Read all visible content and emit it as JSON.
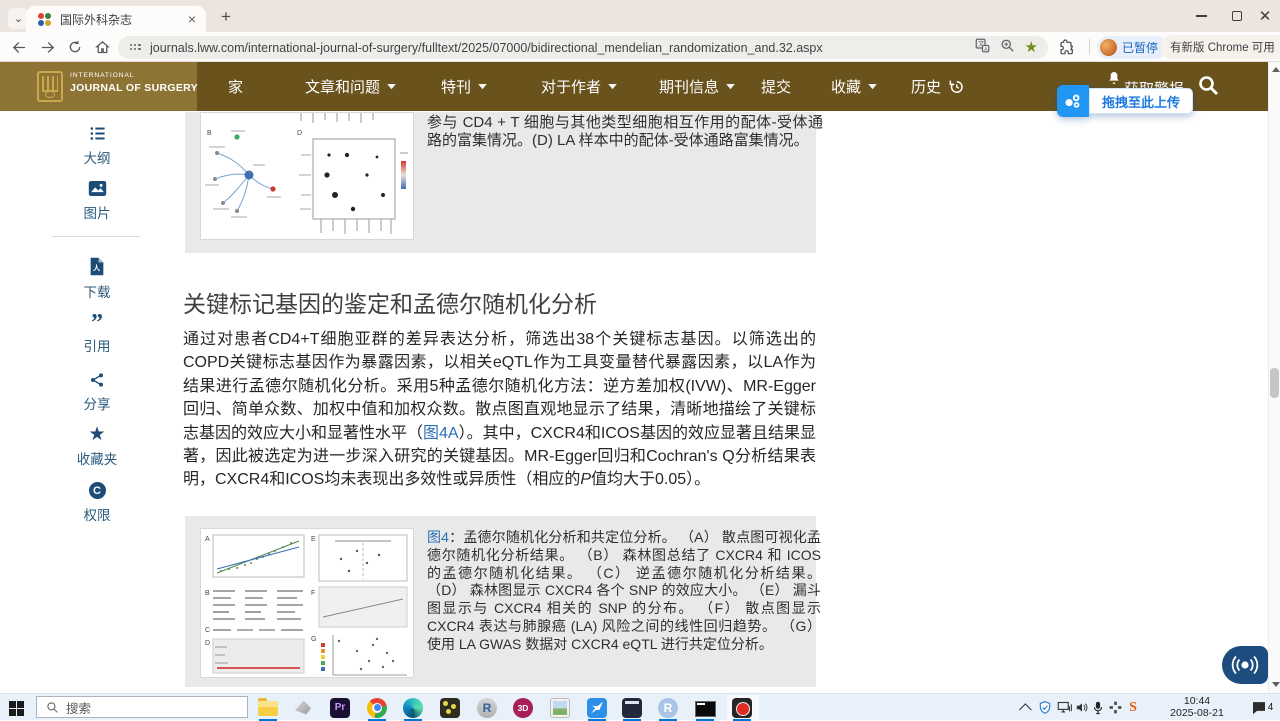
{
  "browser": {
    "tab_title": "国际外科杂志",
    "url": "journals.lww.com/international-journal-of-surgery/fulltext/2025/07000/bidirectional_mendelian_randomization_and.32.aspx",
    "profile_status": "已暂停",
    "update_button": "有新版 Chrome 可用"
  },
  "header": {
    "logo_top": "INTERNATIONAL",
    "logo_bottom": "JOURNAL OF SURGERY",
    "nav": [
      {
        "label": "家"
      },
      {
        "label": "文章和问题"
      },
      {
        "label": "特刊"
      },
      {
        "label": "对于作者"
      },
      {
        "label": "期刊信息"
      },
      {
        "label": "提交"
      },
      {
        "label": "收藏"
      },
      {
        "label": "历史"
      },
      {
        "label": "获取警报"
      }
    ]
  },
  "upload_tooltip": {
    "label": "拖拽至此上传"
  },
  "sidebar": {
    "items": [
      {
        "label": "大纲",
        "icon": "outline-icon"
      },
      {
        "label": "图片",
        "icon": "images-icon"
      },
      {
        "label": "下载",
        "icon": "pdf-download-icon"
      },
      {
        "label": "引用",
        "icon": "cite-icon"
      },
      {
        "label": "分享",
        "icon": "share-icon"
      },
      {
        "label": "收藏夹",
        "icon": "favorites-icon"
      },
      {
        "label": "权限",
        "icon": "permissions-icon"
      }
    ]
  },
  "article": {
    "fig3_caption": "参与 CD4 + T 细胞与其他类型细胞相互作用的配体-受体通路的富集情况。(D) LA 样本中的配体-受体通路富集情况。",
    "section_heading": "关键标记基因的鉴定和孟德尔随机化分析",
    "para_1": "通过对患者CD4+T细胞亚群的差异表达分析，筛选出38个关键标志基因。以筛选出的COPD关键标志基因作为暴露因素，以相关eQTL作为工具变量替代暴露因素，以LA作为结果进行孟德尔随机化分析。采用5种孟德尔随机化方法：逆方差加权(IVW)、MR-Egger回归、简单众数、加权中值和加权众数。散点图直观地显示了结果，清晰地描绘了关键标志基因的效应大小和显著性水平（",
    "para_link": "图4A",
    "para_2": "）。其中，CXCR4和ICOS基因的效应显著且结果显著，因此被选定为进一步深入研究的关键基因。MR-Egger回归和Cochran's Q分析结果表明，CXCR4和ICOS均未表现出多效性或异质性（相应的",
    "para_italic": "P",
    "para_3": "值均大于0.05）。",
    "fig4_label": "图4",
    "fig4_caption": "：孟德尔随机化分析和共定位分析。 （A） 散点图可视化孟德尔随机化分析结果。 （B） 森林图总结了 CXCR4 和 ICOS 的孟德尔随机化结果。 （C） 逆孟德尔随机化分析结果。 （D） 森林图显示 CXCR4 各个 SNP 的效应大小。 （E） 漏斗图显示与 CXCR4 相关的 SNP 的分布。 （F） 散点图显示 CXCR4 表达与肺腺癌 (LA) 风险之间的线性回归趋势。 （G） 使用 LA GWAS 数据对 CXCR4 eQTL 进行共定位分析。"
  },
  "taskbar": {
    "search_placeholder": "搜索",
    "time": "10:44",
    "date": "2025-08-21",
    "notification_count": "4",
    "icons": [
      "file-explorer",
      "3d-viewer",
      "premiere",
      "chrome",
      "edge",
      "game-app",
      "r-project",
      "3ds-max",
      "photos",
      "bluebird-app",
      "terminal-dark",
      "rstudio",
      "console-window",
      "recorder"
    ]
  }
}
